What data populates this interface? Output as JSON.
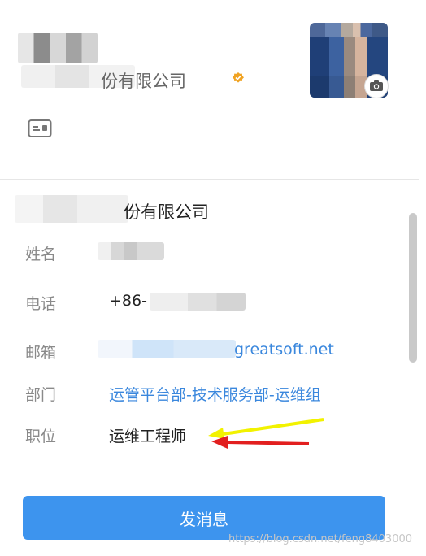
{
  "header": {
    "company_suffix": "份有限公司",
    "verified_icon": "verified-badge-icon",
    "verified_color": "#f0a323",
    "avatar_icon": "camera-icon",
    "card_icon": "id-card-icon"
  },
  "profile": {
    "company": "份有限公司",
    "fields": {
      "name_label": "姓名",
      "phone_label": "电话",
      "phone_prefix": "+86-",
      "email_label": "邮箱",
      "email_domain": "greatsoft.net",
      "dept_label": "部门",
      "dept_value": "运管平台部-技术服务部-运维组",
      "title_label": "职位",
      "title_value": "运维工程师"
    }
  },
  "actions": {
    "send_message": "发消息"
  },
  "watermark": "https://blog.csdn.net/feng8403000",
  "colors": {
    "accent": "#3d94ee",
    "link": "#3a87dd",
    "arrow_yellow": "#f2f200",
    "arrow_red": "#e21f1f"
  }
}
